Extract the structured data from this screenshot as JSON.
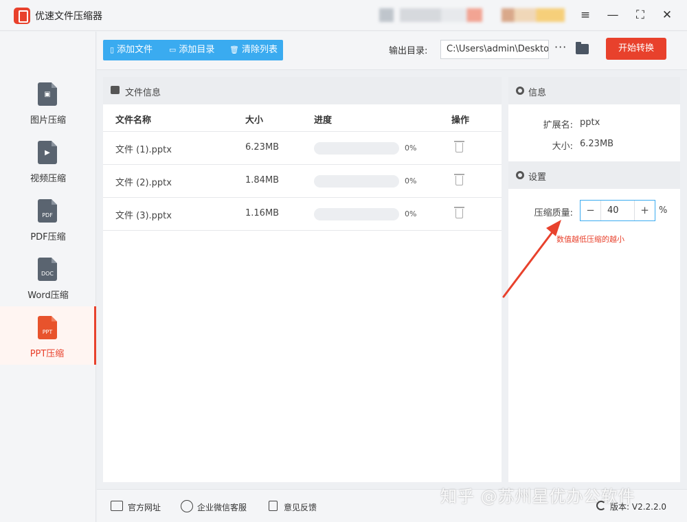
{
  "app": {
    "title": "优速文件压缩器"
  },
  "window_controls": [
    "≡",
    "—",
    "⛶",
    "✕"
  ],
  "sidebar": {
    "items": [
      {
        "label": "图片压缩",
        "tag": "",
        "glyph": "▣",
        "active": false
      },
      {
        "label": "视频压缩",
        "tag": "",
        "glyph": "▶",
        "active": false
      },
      {
        "label": "PDF压缩",
        "tag": "PDF",
        "glyph": "",
        "active": false
      },
      {
        "label": "Word压缩",
        "tag": "DOC",
        "glyph": "",
        "active": false
      },
      {
        "label": "PPT压缩",
        "tag": "PPT",
        "glyph": "",
        "active": true
      }
    ]
  },
  "toolbar": {
    "add_file": "添加文件",
    "add_dir": "添加目录",
    "clear_list": "清除列表",
    "output_label": "输出目录:",
    "output_path": "C:\\Users\\admin\\Deskto",
    "more": "···",
    "start": "开始转换"
  },
  "file_panel": {
    "title": "文件信息",
    "columns": {
      "name": "文件名称",
      "size": "大小",
      "progress": "进度",
      "action": "操作"
    },
    "rows": [
      {
        "name": "文件 (1).pptx",
        "size": "6.23MB",
        "progress": 0,
        "pct": "0%"
      },
      {
        "name": "文件 (2).pptx",
        "size": "1.84MB",
        "progress": 0,
        "pct": "0%"
      },
      {
        "name": "文件 (3).pptx",
        "size": "1.16MB",
        "progress": 0,
        "pct": "0%"
      }
    ]
  },
  "info": {
    "title": "信息",
    "ext_label": "扩展名:",
    "ext_value": "pptx",
    "size_label": "大小:",
    "size_value": "6.23MB"
  },
  "settings": {
    "title": "设置",
    "quality_label": "压缩质量:",
    "quality_value": "40",
    "minus": "−",
    "plus": "+",
    "unit": "%",
    "hint": "数值越低压缩的越小"
  },
  "footer": {
    "website": "官方网址",
    "wechat": "企业微信客服",
    "feedback": "意见反馈",
    "version": "版本: V2.2.2.0",
    "watermark": "知乎 @苏州星优办公软件"
  },
  "colors": {
    "accent": "#e8412c",
    "blue": "#3aabf0"
  }
}
